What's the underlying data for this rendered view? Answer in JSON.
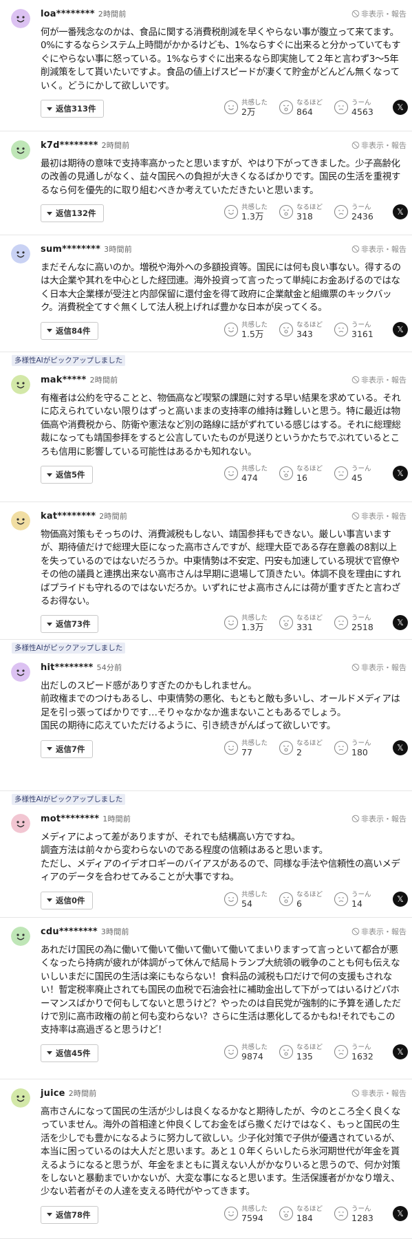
{
  "labels": {
    "hide_report": "非表示・報告",
    "empathy": "共感した",
    "agree": "なるほど",
    "hmm": "うーん",
    "x_share": "𝕏",
    "pickup": "多様性AIがピックアップしました"
  },
  "colors": {
    "avatar_purple": "#dcc2f2",
    "avatar_green": "#bfe6b7",
    "avatar_blue": "#c9d2f4",
    "avatar_lime": "#d3e8a8",
    "avatar_yellow": "#f1dea3",
    "avatar_pink": "#f2c6d2"
  },
  "comments": [
    {
      "avatar_icon": "smiley-avatar-icon",
      "avatar_color": "#dcc2f2",
      "pickup": false,
      "username": "loa********",
      "time": "2時間前",
      "body": "何が一番残念なのかは、食品に関する消費税削減を早くやらない事が腹立って来てます。0%にするならシステム上時間がかかるけども、1%ならすぐに出来ると分かっていてもすぐにやらない事に怒っている。1%ならすぐに出来るなら即実施して２年と言わず3〜5年削減策をして貰いたいですよ。食品の値上げスピードが凄くて貯金がどんどん無くなっていく。どうにかして欲しいです。",
      "reply_label": "返信313件",
      "empathy": "2万",
      "agree": "864",
      "hmm": "4563"
    },
    {
      "avatar_icon": "smiley-avatar-icon",
      "avatar_color": "#bfe6b7",
      "pickup": false,
      "username": "k7d********",
      "time": "2時間前",
      "body": "最初は期待の意味で支持率高かったと思いますが、やはり下がってきました。少子高齢化の改善の見通しがなく、益々国民への負担が大きくなるばかりです。国民の生活を重視するなら何を優先的に取り組むべきか考えていただきたいと思います。",
      "reply_label": "返信132件",
      "empathy": "1.3万",
      "agree": "318",
      "hmm": "2436"
    },
    {
      "avatar_icon": "smiley-avatar-icon",
      "avatar_color": "#c9d2f4",
      "pickup": false,
      "username": "sum********",
      "time": "3時間前",
      "body": "まだそんなに高いのか。増税や海外への多額投資等。国民には何も良い事ない。得するのは大企業や其れを中心とした経団連。海外投資って言ったって単純にお金あげるのではなく日本大企業様が受注と内部保留に還付金を得て政府に企業献金と組織票のキックバック。消費税全てすぐ無くして法人税上げれば豊かな日本が戻ってくる。",
      "reply_label": "返信84件",
      "empathy": "1.5万",
      "agree": "343",
      "hmm": "3161"
    },
    {
      "avatar_icon": "smiley-avatar-icon",
      "avatar_color": "#d3e8a8",
      "pickup": true,
      "username": "mak*****",
      "time": "2時間前",
      "body": "有権者は公約を守ることと、物価高など喫緊の課題に対する早い結果を求めている。それに応えられていない限りはずっと高いままの支持率の維持は難しいと思う。特に最近は物価高や消費税から、防衛や憲法など別の路線に話がずれている感じはする。それに総理総裁になっても靖国参拝をすると公言していたものが見送りというかたちでぶれているところも信用に影響している可能性はあるかも知れない。",
      "reply_label": "返信5件",
      "empathy": "474",
      "agree": "16",
      "hmm": "45"
    },
    {
      "avatar_icon": "smiley-avatar-icon",
      "avatar_color": "#f1dea3",
      "pickup": false,
      "username": "kat********",
      "time": "2時間前",
      "body": "物価高対策もそっちのけ、消費減税もしない、靖国参拝もできない。厳しい事言いますが、期待値だけで総理大臣になった高市さんですが、総理大臣である存在意義の8割以上を失っているのではないだろうか。中東情勢は不安定、円安も加速している現状で官僚やその他の議員と連携出来ない高市さんは早期に退場して頂きたい。体調不良を理由にすればプライドも守れるのではないだろか。いずれにせよ高市さんには荷が重すぎたと言わざるお得ない。",
      "reply_label": "返信73件",
      "empathy": "1.3万",
      "agree": "331",
      "hmm": "2518"
    },
    {
      "avatar_icon": "smiley-avatar-icon",
      "avatar_color": "#dcc2f2",
      "pickup": true,
      "username": "hit********",
      "time": "54分前",
      "body": "出だしのスピード感がありすぎたのかもしれません。\n前政権までのつけもあるし、中東情勢の悪化、もともと敵も多いし、オールドメディアは足を引っ張ってばかりです…そりゃなかなか進まないこともあるでしょう。\n国民の期待に応えていただけるように、引き続きがんばって欲しいです。",
      "reply_label": "返信7件",
      "empathy": "77",
      "agree": "2",
      "hmm": "180"
    },
    {
      "avatar_icon": "smiley-avatar-icon",
      "avatar_color": "#f2c6d2",
      "pickup": true,
      "username": "mot********",
      "time": "1時間前",
      "body": "メディアによって差がありますが、それでも結構高い方ですね。\n調査方法は前々から変わらないのである程度の信頼はあると思います。\nただし、メディアのイデオロギーのバイアスがあるので、同様な手法や信頼性の高いメディアのデータを合わせてみることが大事ですね。",
      "reply_label": "返信0件",
      "empathy": "54",
      "agree": "6",
      "hmm": "14"
    },
    {
      "avatar_icon": "smiley-avatar-icon",
      "avatar_color": "#bfe6b7",
      "pickup": false,
      "username": "cdu********",
      "time": "3時間前",
      "body": "あれだけ国民の為に働いて働いて働いて働いて働いてまいりますって言っといて都合が悪くなったら持病が疲れが体調がって休んで結局トランプ大統領の戦争のことも何も伝えないしいまだに国民の生活は楽にもならない！食料品の減税も口だけで何の支援もされない！暫定税率廃止されても国民の血税で石油会社に補助金出して下がってはいるけどパホーマンスばかりで何もしてないと思うけど？やったのは自民党が強制的に予算を通しただけで別に高市政権の前と何も変わらない？さらに生活は悪化してるかもね!それでもこの支持率は高過ぎると思うけど！",
      "reply_label": "返信45件",
      "empathy": "9874",
      "agree": "135",
      "hmm": "1632"
    },
    {
      "avatar_icon": "smiley-avatar-icon",
      "avatar_color": "#d3e8a8",
      "pickup": false,
      "username": "juice",
      "time": "2時間前",
      "body": "高市さんになって国民の生活が少しは良くなるかなと期待したが、今のところ全く良くなっていません。海外の首相達と仲良くしてお金をばら撒くだけではなく、もっと国民の生活を少しでも豊かになるように努力して欲しい。少子化対策で子供が優遇されているが、本当に困っているのは大人だと思います。あと１０年くらいしたら氷河期世代が年金を貰えるようになると思うが、年金をまともに貰えない人がかなりいると思うので、何か対策をしないと暴動までいかないが、大変な事になると思います。生活保護者がかなり増え、少ない若者がその人達を支える時代がやってきます。",
      "reply_label": "返信78件",
      "empathy": "7594",
      "agree": "184",
      "hmm": "1283"
    }
  ]
}
